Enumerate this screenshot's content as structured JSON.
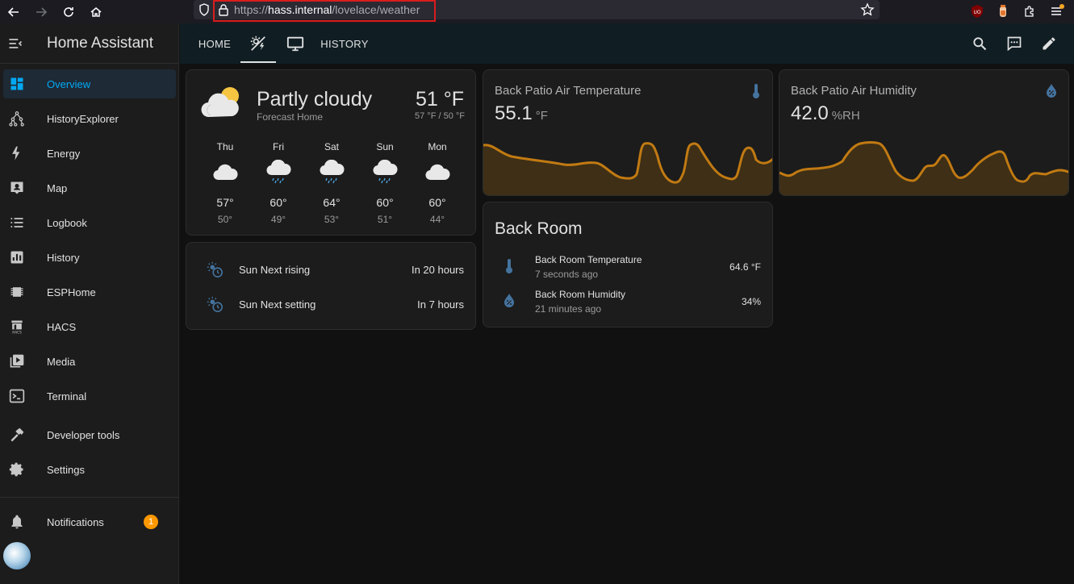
{
  "browser": {
    "url_scheme": "https://",
    "url_host": "hass.internal",
    "url_path": "/lovelace/weather"
  },
  "sidebar": {
    "title": "Home Assistant",
    "items": [
      {
        "label": "Overview",
        "icon": "view-dashboard-icon",
        "active": true
      },
      {
        "label": "HistoryExplorer",
        "icon": "graph-tree-icon"
      },
      {
        "label": "Energy",
        "icon": "lightning-bolt-icon"
      },
      {
        "label": "Map",
        "icon": "account-box-icon"
      },
      {
        "label": "Logbook",
        "icon": "format-list-bulleted-icon"
      },
      {
        "label": "History",
        "icon": "chart-box-icon"
      },
      {
        "label": "ESPHome",
        "icon": "chip-icon"
      },
      {
        "label": "HACS",
        "icon": "hacs-icon"
      },
      {
        "label": "Media",
        "icon": "play-box-multiple-icon"
      },
      {
        "label": "Terminal",
        "icon": "console-icon"
      },
      {
        "label": "Developer tools",
        "icon": "hammer-icon"
      },
      {
        "label": "Settings",
        "icon": "cog-icon"
      }
    ],
    "notifications": {
      "label": "Notifications",
      "count": "1"
    }
  },
  "tabs": [
    {
      "label": "HOME"
    },
    {
      "label": "",
      "icon": "weather-partly-lightning-icon",
      "active": true
    },
    {
      "label": "",
      "icon": "monitor-icon"
    },
    {
      "label": "HISTORY"
    }
  ],
  "weather": {
    "condition": "Partly cloudy",
    "name": "Forecast Home",
    "temperature": "51 °F",
    "range": "57 °F / 50 °F",
    "forecast": [
      {
        "day": "Thu",
        "hi": "57°",
        "lo": "50°",
        "icon": "cloudy-icon"
      },
      {
        "day": "Fri",
        "hi": "60°",
        "lo": "49°",
        "icon": "rainy-icon"
      },
      {
        "day": "Sat",
        "hi": "64°",
        "lo": "53°",
        "icon": "rainy-icon"
      },
      {
        "day": "Sun",
        "hi": "60°",
        "lo": "51°",
        "icon": "rainy-icon"
      },
      {
        "day": "Mon",
        "hi": "60°",
        "lo": "44°",
        "icon": "cloudy-icon"
      }
    ]
  },
  "sun": [
    {
      "label": "Sun Next rising",
      "value": "In 20 hours"
    },
    {
      "label": "Sun Next setting",
      "value": "In 7 hours"
    }
  ],
  "temp_sensor": {
    "name": "Back Patio Air Temperature",
    "value": "55.1",
    "unit": "°F"
  },
  "humidity_sensor": {
    "name": "Back Patio Air Humidity",
    "value": "42.0",
    "unit": "%RH"
  },
  "back_room": {
    "title": "Back Room",
    "entities": [
      {
        "name": "Back Room Temperature",
        "sub": "7 seconds ago",
        "value": "64.6 °F",
        "icon": "thermometer-icon"
      },
      {
        "name": "Back Room Humidity",
        "sub": "21 minutes ago",
        "value": "34%",
        "icon": "water-percent-icon"
      }
    ]
  },
  "colors": {
    "accent": "#03a9f4",
    "sensor_line": "#c17a12",
    "badge": "#ff9800"
  }
}
